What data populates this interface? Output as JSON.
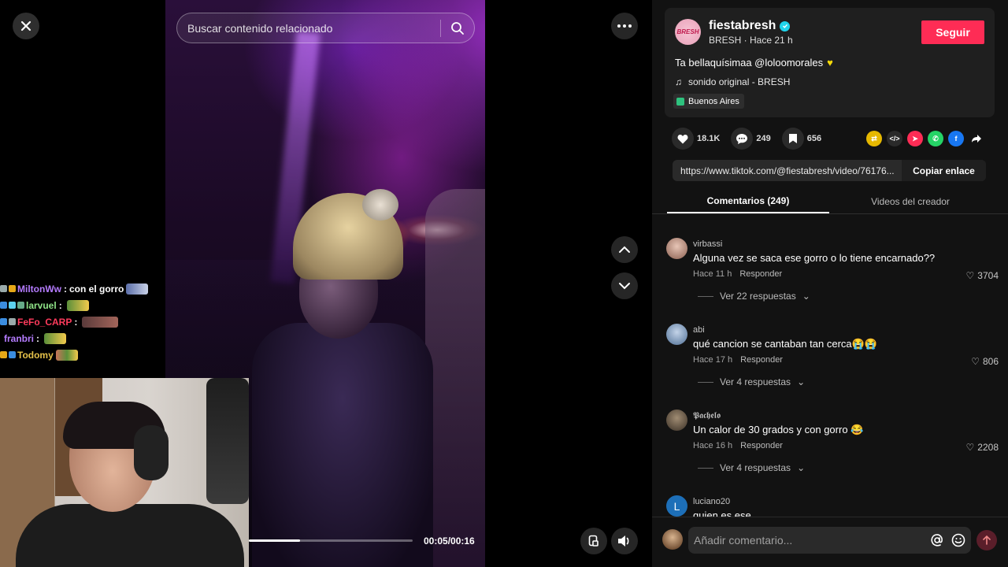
{
  "search": {
    "placeholder": "Buscar contenido relacionado"
  },
  "video": {
    "time": "00:05/00:16",
    "progress": 0.3125
  },
  "chat": [
    {
      "user": "MiltonWw",
      "message": "con el gorro",
      "color": "#b57cff"
    },
    {
      "user": "larvuel",
      "message": "",
      "color": "#8fe388"
    },
    {
      "user": "FeFo_CARP",
      "message": "",
      "color": "#ff3b5c"
    },
    {
      "user": "franbri",
      "message": "",
      "color": "#b57cff"
    },
    {
      "user": "Todomy",
      "message": "",
      "color": "#e6c24a"
    }
  ],
  "creator": {
    "name": "fiestabresh",
    "subtitle": "BRESH · Hace 21 h",
    "avatar_text": "BRESH",
    "follow_label": "Seguir",
    "description": "Ta bellaquísimaa @loloomorales",
    "sound": "sonido original - BRESH",
    "location": "Buenos Aires"
  },
  "stats": {
    "likes": "18.1K",
    "comments": "249",
    "saves": "656"
  },
  "link": {
    "url": "https://www.tiktok.com/@fiestabresh/video/76176...",
    "copy_label": "Copiar enlace"
  },
  "tabs": {
    "comments": "Comentarios (249)",
    "videos": "Videos del creador"
  },
  "comments": [
    {
      "user": "virbassi",
      "text": "Alguna vez se saca ese gorro o lo tiene encarnado??",
      "time": "Hace 11 h",
      "reply": "Responder",
      "likes": "3704",
      "more": "Ver 22 respuestas",
      "avatar_color": "#c9a89a"
    },
    {
      "user": "abi",
      "text": "qué cancion se cantaban tan cerca😭😭",
      "time": "Hace 17 h",
      "reply": "Responder",
      "likes": "806",
      "more": "Ver 4 respuestas",
      "avatar_color": "#7a9cc0"
    },
    {
      "user": "𝕻𝖆𝖈𝖍𝖊𝖑𝖔",
      "text": "Un calor de 30 grados y con gorro 😂",
      "time": "Hace 16 h",
      "reply": "Responder",
      "likes": "2208",
      "more": "Ver 4 respuestas",
      "avatar_color": "#6b5a48"
    },
    {
      "user": "luciano20",
      "text": "quien es ese",
      "time": "",
      "reply": "",
      "likes": "",
      "more": "",
      "avatar_color": "#1d6fb8",
      "avatar_letter": "L"
    }
  ],
  "composer": {
    "placeholder": "Añadir comentario..."
  }
}
